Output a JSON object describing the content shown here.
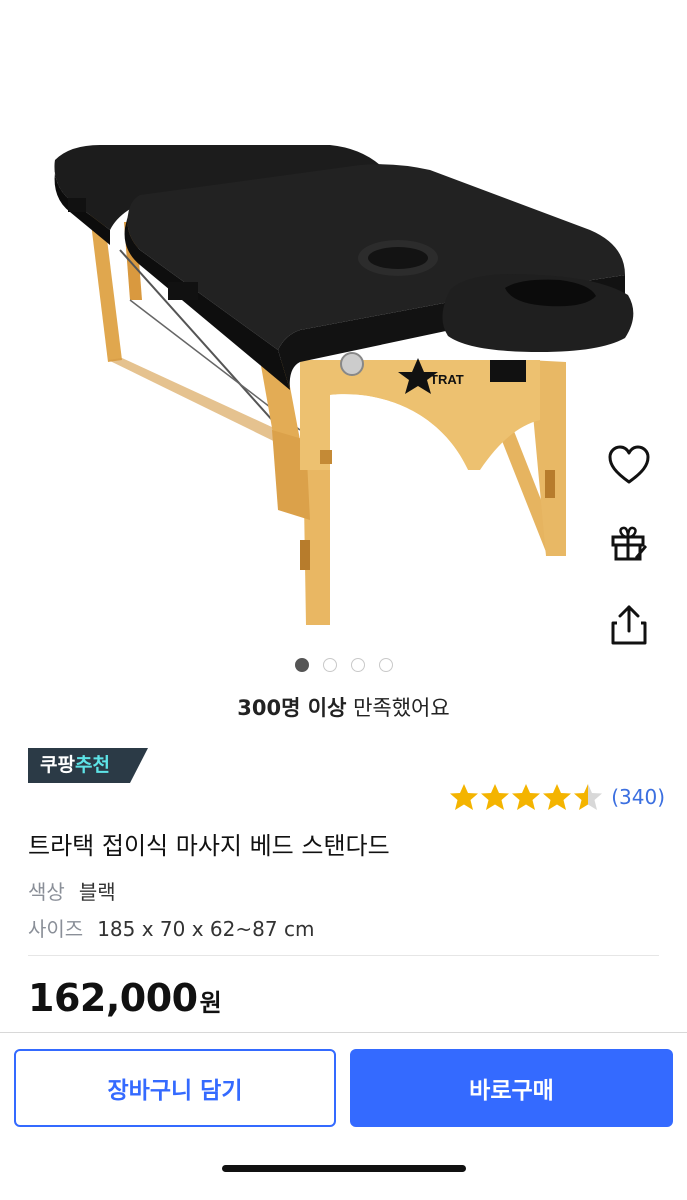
{
  "product": {
    "image_alt": "folding massage bed",
    "brand_mark": "TRAT",
    "carousel": {
      "total": 4,
      "active": 1
    },
    "satisfaction_bold": "300명 이상",
    "satisfaction_rest": " 만족했어요",
    "badge_main": "쿠팡",
    "badge_accent": "추천",
    "rating_value": 4.5,
    "review_count": "(340)",
    "title": "트라택 접이식 마사지 베드 스탠다드",
    "options": [
      {
        "label": "색상",
        "value": "블랙"
      },
      {
        "label": "사이즈",
        "value": "185 x 70 x 62~87 cm"
      }
    ],
    "price": "162,000",
    "price_unit": "원"
  },
  "icons": {
    "like": "heart-icon",
    "gift": "gift-icon",
    "share": "share-icon"
  },
  "actions": {
    "cart_label": "장바구니 담기",
    "buy_label": "바로구매"
  },
  "colors": {
    "accent": "#346aff",
    "star": "#f4b400",
    "badge_bg": "#2b3a46",
    "badge_accent": "#5ee4e7",
    "review_link": "#3b6fe0"
  }
}
